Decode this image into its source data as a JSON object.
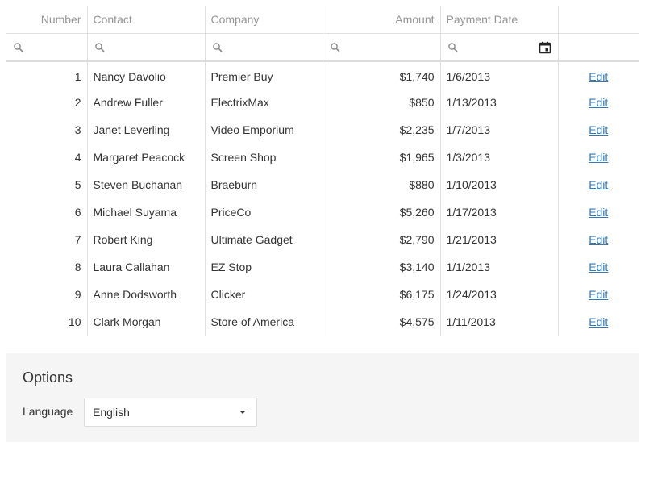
{
  "columns": [
    {
      "label": "Number"
    },
    {
      "label": "Contact"
    },
    {
      "label": "Company"
    },
    {
      "label": "Amount"
    },
    {
      "label": "Payment Date"
    },
    {
      "label": ""
    }
  ],
  "rows": [
    {
      "number": "1",
      "contact": "Nancy Davolio",
      "company": "Premier Buy",
      "amount": "$1,740",
      "date": "1/6/2013",
      "action": "Edit"
    },
    {
      "number": "2",
      "contact": "Andrew Fuller",
      "company": "ElectrixMax",
      "amount": "$850",
      "date": "1/13/2013",
      "action": "Edit"
    },
    {
      "number": "3",
      "contact": "Janet Leverling",
      "company": "Video Emporium",
      "amount": "$2,235",
      "date": "1/7/2013",
      "action": "Edit"
    },
    {
      "number": "4",
      "contact": "Margaret Peacock",
      "company": "Screen Shop",
      "amount": "$1,965",
      "date": "1/3/2013",
      "action": "Edit"
    },
    {
      "number": "5",
      "contact": "Steven Buchanan",
      "company": "Braeburn",
      "amount": "$880",
      "date": "1/10/2013",
      "action": "Edit"
    },
    {
      "number": "6",
      "contact": "Michael Suyama",
      "company": "PriceCo",
      "amount": "$5,260",
      "date": "1/17/2013",
      "action": "Edit"
    },
    {
      "number": "7",
      "contact": "Robert King",
      "company": "Ultimate Gadget",
      "amount": "$2,790",
      "date": "1/21/2013",
      "action": "Edit"
    },
    {
      "number": "8",
      "contact": "Laura Callahan",
      "company": "EZ Stop",
      "amount": "$3,140",
      "date": "1/1/2013",
      "action": "Edit"
    },
    {
      "number": "9",
      "contact": "Anne Dodsworth",
      "company": "Clicker",
      "amount": "$6,175",
      "date": "1/24/2013",
      "action": "Edit"
    },
    {
      "number": "10",
      "contact": "Clark Morgan",
      "company": "Store of America",
      "amount": "$4,575",
      "date": "1/11/2013",
      "action": "Edit"
    }
  ],
  "filters": {
    "icon": "search-icon",
    "date_icon": "calendar-icon"
  },
  "options": {
    "title": "Options",
    "language_label": "Language",
    "language_value": "English"
  },
  "colors": {
    "link": "#337ab7",
    "header_text": "#959595",
    "panel_bg": "#f5f5f5"
  }
}
